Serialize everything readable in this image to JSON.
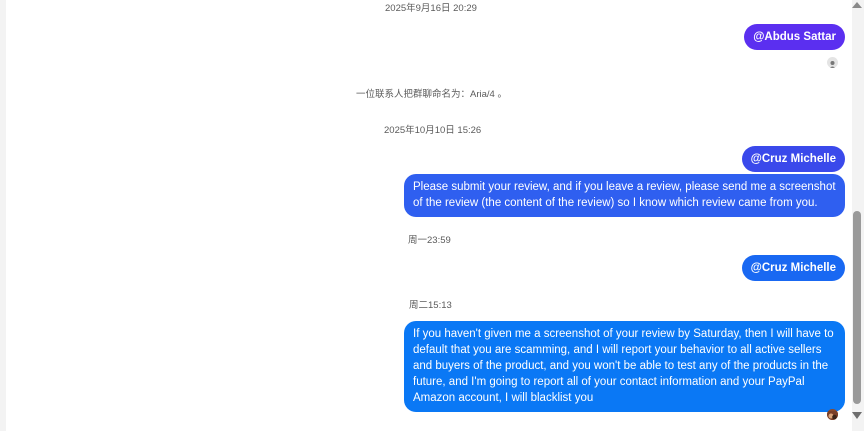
{
  "messages": {
    "timestamp_1": "2025年9月16日 20:29",
    "mention_1": "@Abdus Sattar",
    "system_note": "一位联系人把群聊命名为：Aria/4 。",
    "timestamp_2": "2025年10月10日 15:26",
    "mention_2": "@Cruz Michelle",
    "message_1": "Please submit your review, and if you leave a review, please send me a screenshot of the review (the content of the review) so I know which review came from you.",
    "timestamp_3": "周一23:59",
    "mention_3": "@Cruz Michelle",
    "timestamp_4": "周二15:13",
    "message_2": "If you haven't given me a screenshot of your review by Saturday, then I will have to default that you are scamming, and I will report your behavior to all active sellers and buyers of the product, and you won't be able to test any of the products in the future, and I'm going to report all of your contact information and your PayPal Amazon account, I will blacklist you"
  },
  "icons": {
    "read_receipt_1": "person-avatar-icon",
    "read_receipt_2": "profile-photo-icon",
    "scroll_down": "chevron-down-icon"
  },
  "colors": {
    "bubble_purple": "#5b2ff0",
    "bubble_blue": "#0a78f5",
    "scrollbar_thumb": "#9a9a9a"
  }
}
